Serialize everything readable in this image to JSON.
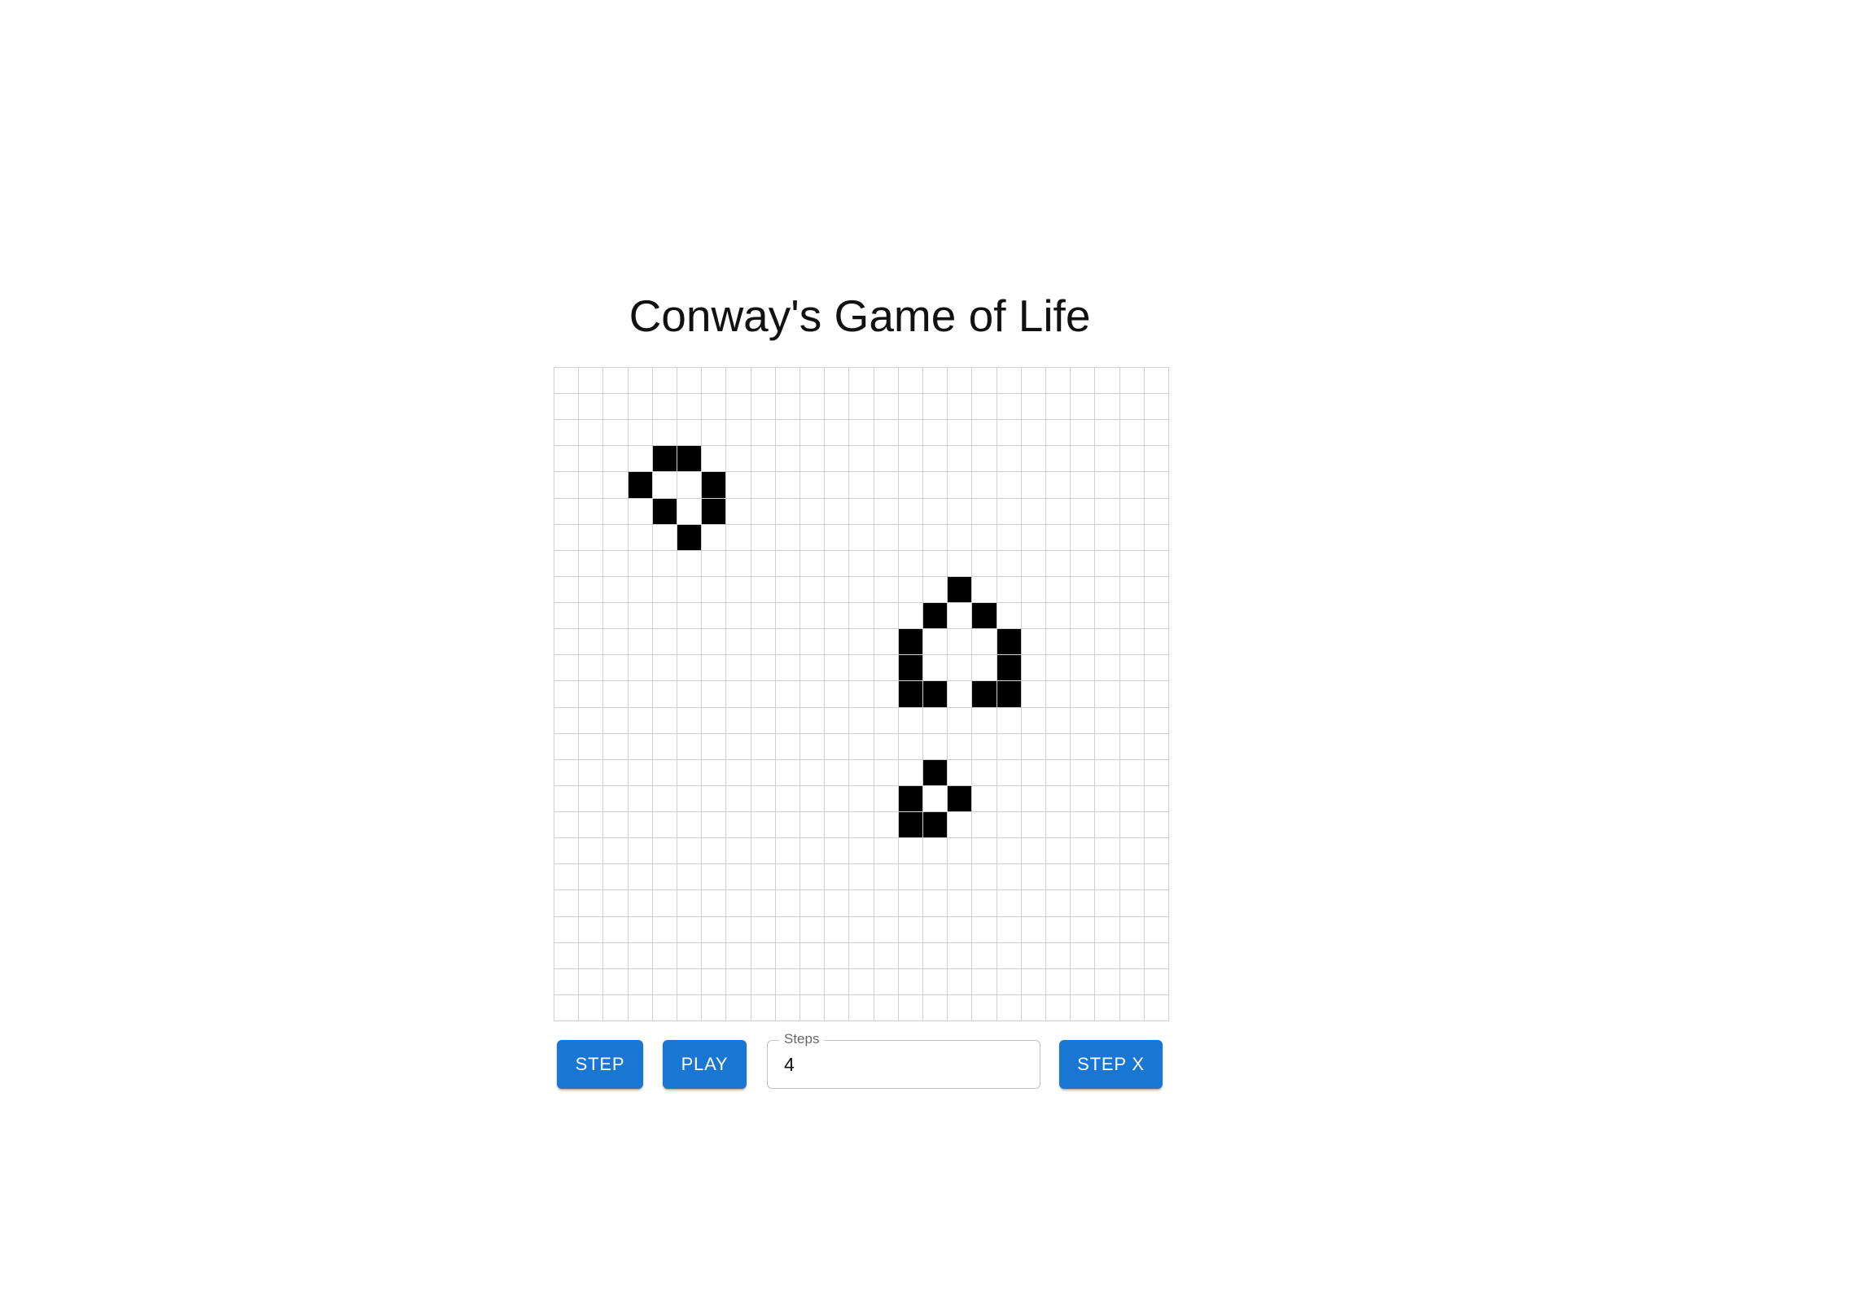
{
  "title": "Conway's Game of Life",
  "grid": {
    "rows": 25,
    "cols": 25,
    "alive_color": "#000000",
    "dead_color": "#ffffff",
    "line_color": "#cfcfcf",
    "alive_cells": [
      [
        3,
        4
      ],
      [
        3,
        5
      ],
      [
        4,
        3
      ],
      [
        4,
        6
      ],
      [
        5,
        4
      ],
      [
        5,
        6
      ],
      [
        6,
        5
      ],
      [
        8,
        16
      ],
      [
        9,
        15
      ],
      [
        9,
        17
      ],
      [
        10,
        14
      ],
      [
        10,
        18
      ],
      [
        11,
        14
      ],
      [
        11,
        18
      ],
      [
        12,
        14
      ],
      [
        12,
        15
      ],
      [
        12,
        17
      ],
      [
        12,
        18
      ],
      [
        15,
        15
      ],
      [
        16,
        14
      ],
      [
        16,
        16
      ],
      [
        17,
        14
      ],
      [
        17,
        15
      ]
    ]
  },
  "controls": {
    "step_label": "Step",
    "play_label": "Play",
    "steps_field_label": "Steps",
    "steps_value": "4",
    "step_x_label": "Step X",
    "button_color": "#1976d2"
  }
}
